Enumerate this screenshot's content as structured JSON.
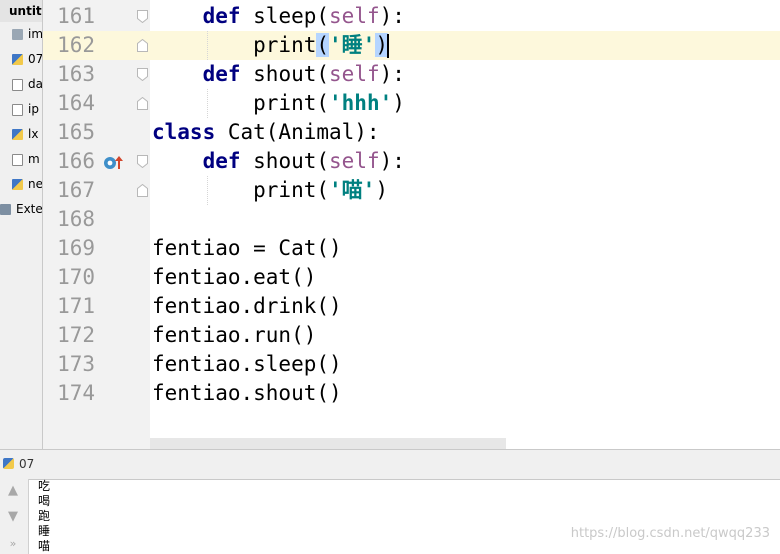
{
  "project": {
    "root": "untit",
    "items": [
      {
        "label": "im",
        "icon": "folder-icon"
      },
      {
        "label": "07",
        "icon": "python-file-icon"
      },
      {
        "label": "da",
        "icon": "text-file-icon"
      },
      {
        "label": "ip",
        "icon": "text-file-icon"
      },
      {
        "label": "lx",
        "icon": "python-file-icon"
      },
      {
        "label": "m",
        "icon": "text-file-icon"
      },
      {
        "label": "ne",
        "icon": "python-file-icon"
      }
    ],
    "external": "Exter"
  },
  "editor": {
    "lines": [
      {
        "n": "161",
        "tokens": [
          [
            "    ",
            ""
          ],
          [
            "def",
            "kw"
          ],
          [
            " sleep(",
            ""
          ],
          [
            "self",
            "self"
          ],
          [
            "):",
            ""
          ]
        ]
      },
      {
        "n": "162",
        "current": true,
        "tokens": [
          [
            "        print",
            ""
          ],
          [
            "(",
            "hl"
          ],
          [
            "'睡'",
            "str"
          ],
          [
            ")",
            "hl"
          ]
        ]
      },
      {
        "n": "163",
        "tokens": [
          [
            "    ",
            ""
          ],
          [
            "def",
            "kw"
          ],
          [
            " shout(",
            ""
          ],
          [
            "self",
            "self"
          ],
          [
            "):",
            ""
          ]
        ]
      },
      {
        "n": "164",
        "tokens": [
          [
            "        print(",
            ""
          ],
          [
            "'hhh'",
            "str"
          ],
          [
            ")",
            ""
          ]
        ]
      },
      {
        "n": "165",
        "tokens": [
          [
            "class",
            "kw"
          ],
          [
            " Cat(Animal):",
            ""
          ]
        ]
      },
      {
        "n": "166",
        "tokens": [
          [
            "    ",
            ""
          ],
          [
            "def",
            "kw"
          ],
          [
            " shout(",
            ""
          ],
          [
            "self",
            "self"
          ],
          [
            "):",
            ""
          ]
        ]
      },
      {
        "n": "167",
        "tokens": [
          [
            "        print(",
            ""
          ],
          [
            "'喵'",
            "str"
          ],
          [
            ")",
            ""
          ]
        ]
      },
      {
        "n": "168",
        "tokens": []
      },
      {
        "n": "169",
        "tokens": [
          [
            "fentiao = Cat()",
            ""
          ]
        ]
      },
      {
        "n": "170",
        "tokens": [
          [
            "fentiao.eat()",
            ""
          ]
        ]
      },
      {
        "n": "171",
        "tokens": [
          [
            "fentiao.drink()",
            ""
          ]
        ]
      },
      {
        "n": "172",
        "tokens": [
          [
            "fentiao.run()",
            ""
          ]
        ]
      },
      {
        "n": "173",
        "tokens": [
          [
            "fentiao.sleep()",
            ""
          ]
        ]
      },
      {
        "n": "174",
        "tokens": [
          [
            "fentiao.shout()",
            ""
          ]
        ]
      }
    ]
  },
  "run": {
    "config": "07",
    "output": [
      "吃",
      "喝",
      "跑",
      "睡",
      "喵"
    ]
  },
  "watermark": "https://blog.csdn.net/qwqq233",
  "colors": {
    "keyword": "#000080",
    "self": "#94558d",
    "string": "#008080",
    "current_line": "#fdf8dc",
    "brace_highlight": "#b5d5ff"
  }
}
